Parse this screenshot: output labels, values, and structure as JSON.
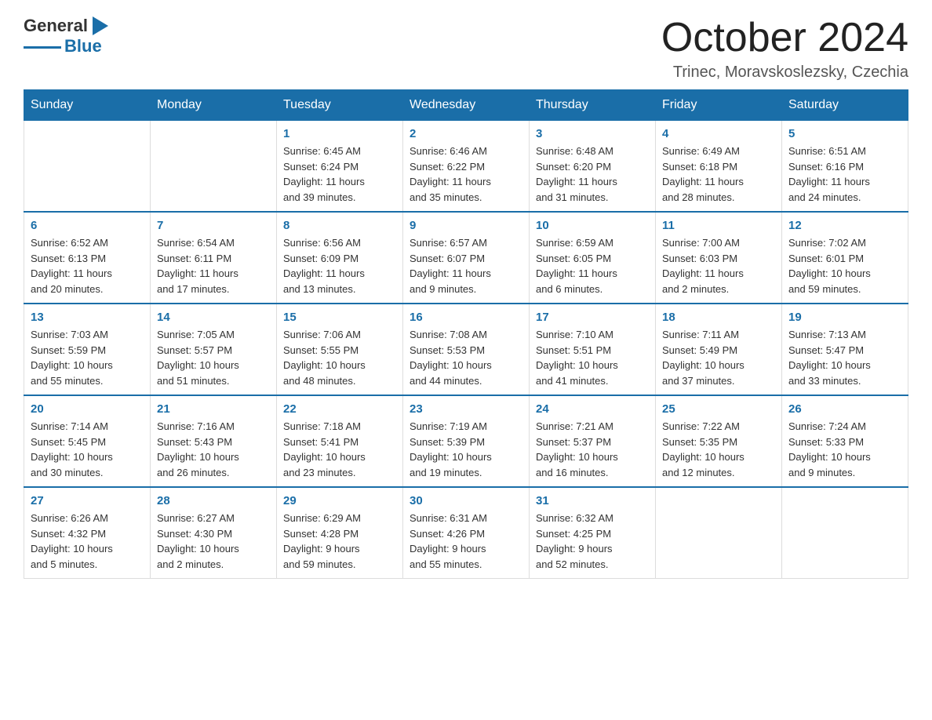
{
  "header": {
    "logo_general": "General",
    "logo_blue": "Blue",
    "month_title": "October 2024",
    "location": "Trinec, Moravskoslezsky, Czechia"
  },
  "days_of_week": [
    "Sunday",
    "Monday",
    "Tuesday",
    "Wednesday",
    "Thursday",
    "Friday",
    "Saturday"
  ],
  "weeks": [
    [
      {
        "num": "",
        "info": ""
      },
      {
        "num": "",
        "info": ""
      },
      {
        "num": "1",
        "info": "Sunrise: 6:45 AM\nSunset: 6:24 PM\nDaylight: 11 hours\nand 39 minutes."
      },
      {
        "num": "2",
        "info": "Sunrise: 6:46 AM\nSunset: 6:22 PM\nDaylight: 11 hours\nand 35 minutes."
      },
      {
        "num": "3",
        "info": "Sunrise: 6:48 AM\nSunset: 6:20 PM\nDaylight: 11 hours\nand 31 minutes."
      },
      {
        "num": "4",
        "info": "Sunrise: 6:49 AM\nSunset: 6:18 PM\nDaylight: 11 hours\nand 28 minutes."
      },
      {
        "num": "5",
        "info": "Sunrise: 6:51 AM\nSunset: 6:16 PM\nDaylight: 11 hours\nand 24 minutes."
      }
    ],
    [
      {
        "num": "6",
        "info": "Sunrise: 6:52 AM\nSunset: 6:13 PM\nDaylight: 11 hours\nand 20 minutes."
      },
      {
        "num": "7",
        "info": "Sunrise: 6:54 AM\nSunset: 6:11 PM\nDaylight: 11 hours\nand 17 minutes."
      },
      {
        "num": "8",
        "info": "Sunrise: 6:56 AM\nSunset: 6:09 PM\nDaylight: 11 hours\nand 13 minutes."
      },
      {
        "num": "9",
        "info": "Sunrise: 6:57 AM\nSunset: 6:07 PM\nDaylight: 11 hours\nand 9 minutes."
      },
      {
        "num": "10",
        "info": "Sunrise: 6:59 AM\nSunset: 6:05 PM\nDaylight: 11 hours\nand 6 minutes."
      },
      {
        "num": "11",
        "info": "Sunrise: 7:00 AM\nSunset: 6:03 PM\nDaylight: 11 hours\nand 2 minutes."
      },
      {
        "num": "12",
        "info": "Sunrise: 7:02 AM\nSunset: 6:01 PM\nDaylight: 10 hours\nand 59 minutes."
      }
    ],
    [
      {
        "num": "13",
        "info": "Sunrise: 7:03 AM\nSunset: 5:59 PM\nDaylight: 10 hours\nand 55 minutes."
      },
      {
        "num": "14",
        "info": "Sunrise: 7:05 AM\nSunset: 5:57 PM\nDaylight: 10 hours\nand 51 minutes."
      },
      {
        "num": "15",
        "info": "Sunrise: 7:06 AM\nSunset: 5:55 PM\nDaylight: 10 hours\nand 48 minutes."
      },
      {
        "num": "16",
        "info": "Sunrise: 7:08 AM\nSunset: 5:53 PM\nDaylight: 10 hours\nand 44 minutes."
      },
      {
        "num": "17",
        "info": "Sunrise: 7:10 AM\nSunset: 5:51 PM\nDaylight: 10 hours\nand 41 minutes."
      },
      {
        "num": "18",
        "info": "Sunrise: 7:11 AM\nSunset: 5:49 PM\nDaylight: 10 hours\nand 37 minutes."
      },
      {
        "num": "19",
        "info": "Sunrise: 7:13 AM\nSunset: 5:47 PM\nDaylight: 10 hours\nand 33 minutes."
      }
    ],
    [
      {
        "num": "20",
        "info": "Sunrise: 7:14 AM\nSunset: 5:45 PM\nDaylight: 10 hours\nand 30 minutes."
      },
      {
        "num": "21",
        "info": "Sunrise: 7:16 AM\nSunset: 5:43 PM\nDaylight: 10 hours\nand 26 minutes."
      },
      {
        "num": "22",
        "info": "Sunrise: 7:18 AM\nSunset: 5:41 PM\nDaylight: 10 hours\nand 23 minutes."
      },
      {
        "num": "23",
        "info": "Sunrise: 7:19 AM\nSunset: 5:39 PM\nDaylight: 10 hours\nand 19 minutes."
      },
      {
        "num": "24",
        "info": "Sunrise: 7:21 AM\nSunset: 5:37 PM\nDaylight: 10 hours\nand 16 minutes."
      },
      {
        "num": "25",
        "info": "Sunrise: 7:22 AM\nSunset: 5:35 PM\nDaylight: 10 hours\nand 12 minutes."
      },
      {
        "num": "26",
        "info": "Sunrise: 7:24 AM\nSunset: 5:33 PM\nDaylight: 10 hours\nand 9 minutes."
      }
    ],
    [
      {
        "num": "27",
        "info": "Sunrise: 6:26 AM\nSunset: 4:32 PM\nDaylight: 10 hours\nand 5 minutes."
      },
      {
        "num": "28",
        "info": "Sunrise: 6:27 AM\nSunset: 4:30 PM\nDaylight: 10 hours\nand 2 minutes."
      },
      {
        "num": "29",
        "info": "Sunrise: 6:29 AM\nSunset: 4:28 PM\nDaylight: 9 hours\nand 59 minutes."
      },
      {
        "num": "30",
        "info": "Sunrise: 6:31 AM\nSunset: 4:26 PM\nDaylight: 9 hours\nand 55 minutes."
      },
      {
        "num": "31",
        "info": "Sunrise: 6:32 AM\nSunset: 4:25 PM\nDaylight: 9 hours\nand 52 minutes."
      },
      {
        "num": "",
        "info": ""
      },
      {
        "num": "",
        "info": ""
      }
    ]
  ]
}
